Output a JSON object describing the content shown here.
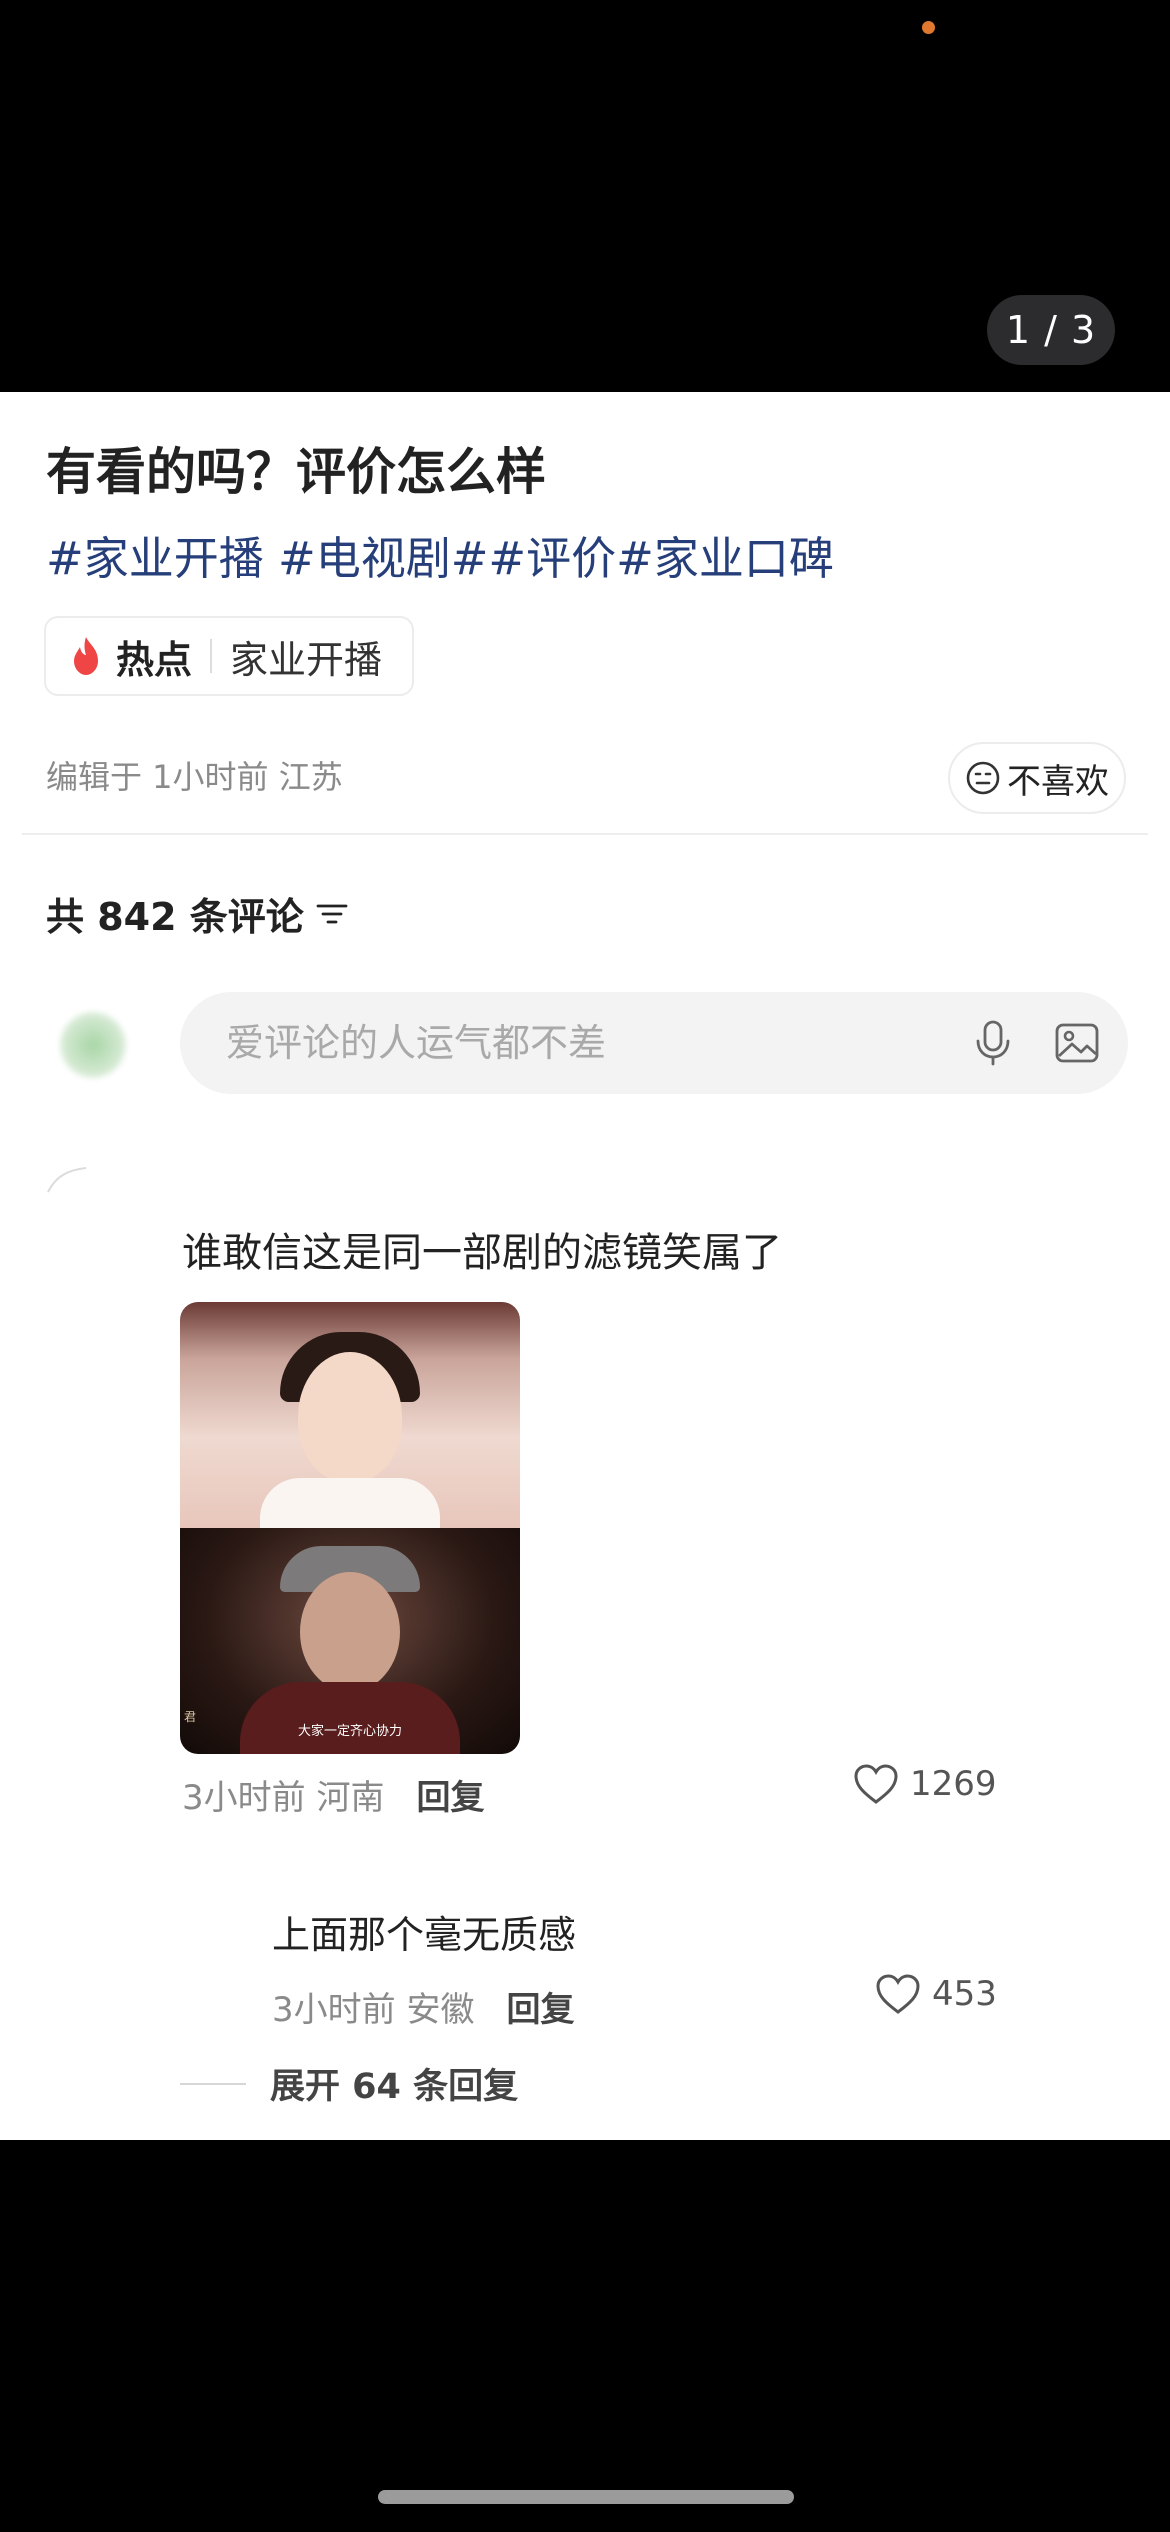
{
  "media": {
    "page_indicator": "1 / 3"
  },
  "post": {
    "title": "有看的吗？评价怎么样",
    "tags": "#家业开播 #电视剧##评价#家业口碑",
    "hot_label": "热点",
    "hot_topic": "家业开播",
    "meta": "编辑于 1小时前 江苏",
    "dislike_label": "不喜欢"
  },
  "comments_section": {
    "count_label": "共 842 条评论",
    "input_placeholder": "爱评论的人运气都不差"
  },
  "comments": [
    {
      "text": "谁敢信这是同一部剧的滤镜笑属了",
      "image_subtitle": "大家一定齐心协力",
      "image_side_mark": "君",
      "time": "3小时前",
      "location": "河南",
      "reply_label": "回复",
      "likes": "1269"
    }
  ],
  "replies": [
    {
      "text": "上面那个毫无质感",
      "time": "3小时前",
      "location": "安徽",
      "reply_label": "回复",
      "likes": "453"
    }
  ],
  "expand_replies_label": "展开 64 条回复",
  "colors": {
    "tag_blue": "#263f7a",
    "flame_red": "#f04545",
    "dot_orange": "#e0782f"
  }
}
